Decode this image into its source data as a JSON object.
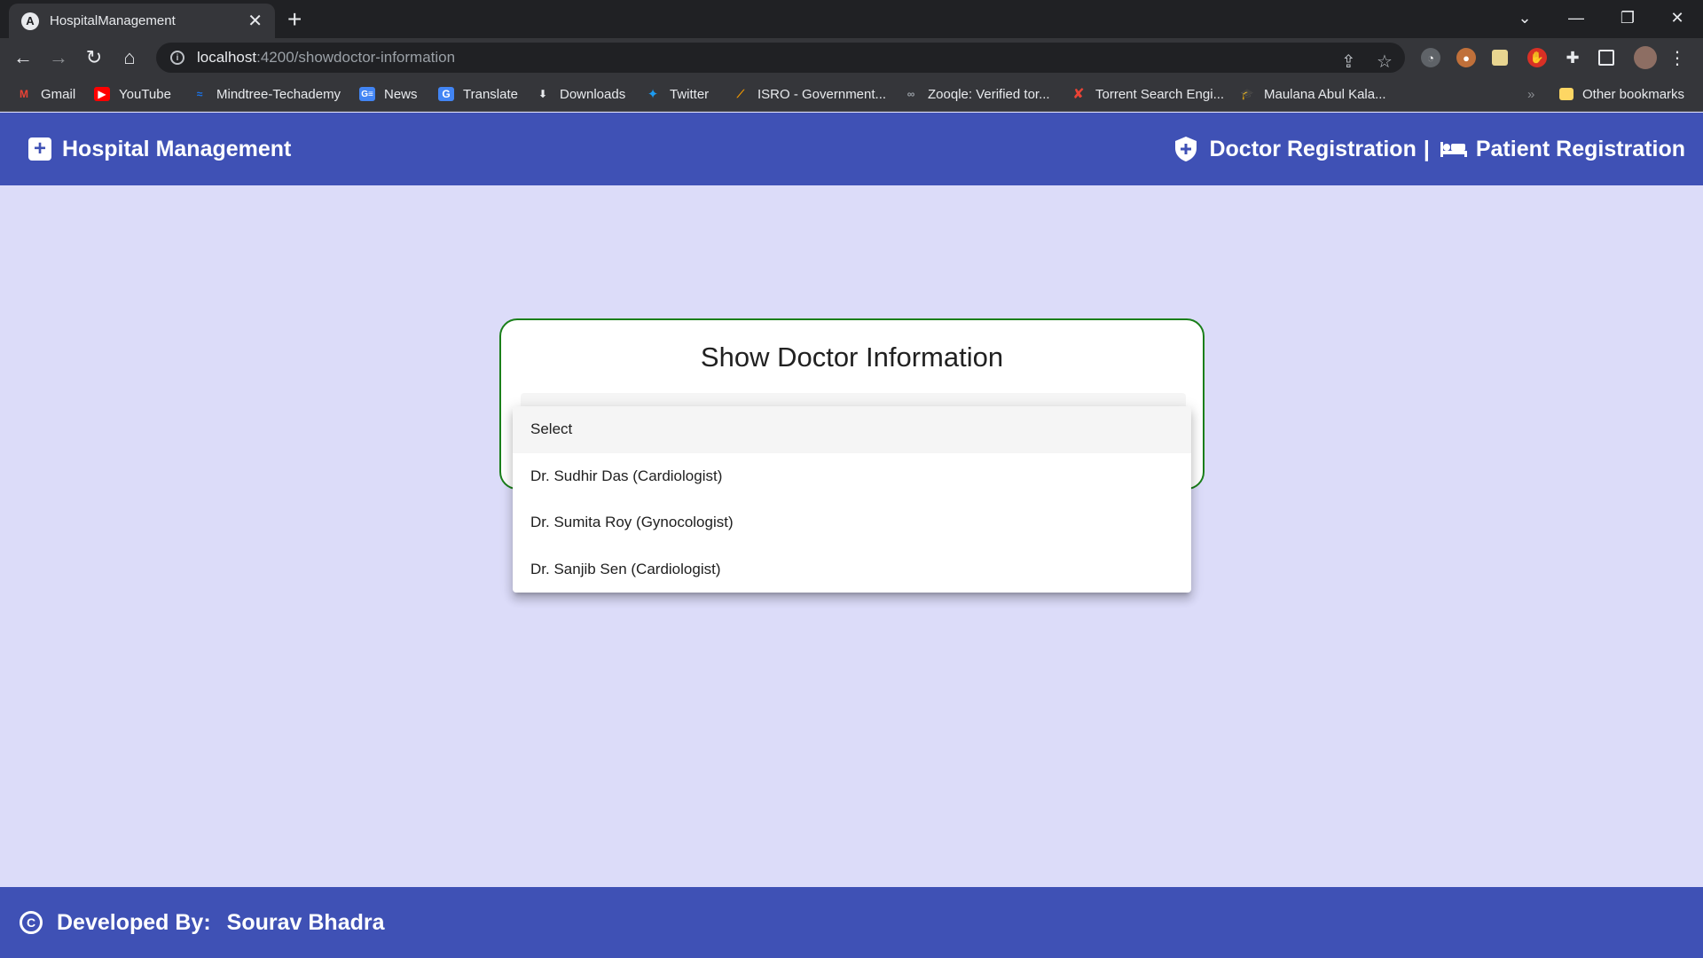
{
  "browser": {
    "tab_title": "HospitalManagement",
    "tab_favicon": "A",
    "url_host": "localhost",
    "url_path": ":4200/showdoctor-information",
    "bookmarks": [
      {
        "label": "Gmail",
        "icon": "gmail-icon"
      },
      {
        "label": "YouTube",
        "icon": "youtube-icon"
      },
      {
        "label": "Mindtree-Techademy",
        "icon": "mindtree-icon"
      },
      {
        "label": "News",
        "icon": "news-icon"
      },
      {
        "label": "Translate",
        "icon": "translate-icon"
      },
      {
        "label": "Downloads",
        "icon": "download-icon"
      },
      {
        "label": "Twitter",
        "icon": "twitter-icon"
      },
      {
        "label": "ISRO - Government...",
        "icon": "isro-icon"
      },
      {
        "label": "Zooqle: Verified tor...",
        "icon": "zooqle-icon"
      },
      {
        "label": "Torrent Search Engi...",
        "icon": "torrent-icon"
      },
      {
        "label": "Maulana Abul Kala...",
        "icon": "graduation-icon"
      }
    ],
    "other_bookmarks": "Other bookmarks"
  },
  "app": {
    "brand": "Hospital Management",
    "nav": {
      "doctor": "Doctor Registration",
      "separator": "|",
      "patient": "Patient Registration"
    },
    "card_title": "Show Doctor Information",
    "select_options": [
      "Select",
      "Dr. Sudhir Das (Cardiologist)",
      "Dr. Sumita Roy (Gynocologist)",
      "Dr. Sanjib Sen (Cardiologist)"
    ],
    "footer": {
      "label": "Developed By:",
      "author": "Sourav Bhadra"
    }
  },
  "colors": {
    "primary": "#3f51b5",
    "page_bg": "#dcdcf9",
    "card_border": "#1a7f1a"
  }
}
